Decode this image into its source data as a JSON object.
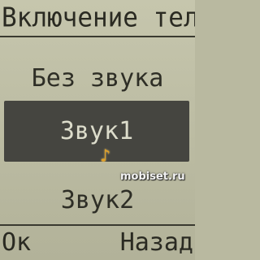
{
  "header": {
    "title": "Включение теле"
  },
  "menu": {
    "items": [
      {
        "label": "Без звука",
        "selected": false
      },
      {
        "label": "Звук1",
        "selected": true
      },
      {
        "label": "Звук2",
        "selected": false
      }
    ]
  },
  "indicators": {
    "selected_icon": "music-note-icon"
  },
  "watermark": {
    "text": "mobiset.ru"
  },
  "softkeys": {
    "left": "Ок",
    "right": "Назад"
  },
  "colors": {
    "background": "#c6c6ad",
    "selection": "#454540",
    "text": "#2e2e26",
    "selected_text": "#dcdccb",
    "icon": "#e0a028"
  }
}
